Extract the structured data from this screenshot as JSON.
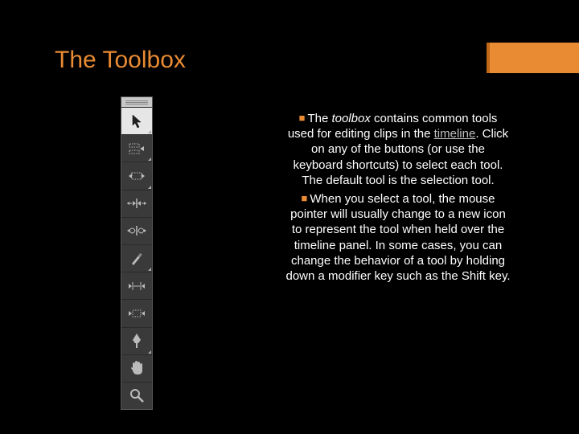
{
  "title": "The Toolbox",
  "tools": [
    "selection-tool",
    "track-select-tool",
    "ripple-edit-tool",
    "rolling-edit-tool",
    "rate-stretch-tool",
    "razor-tool",
    "slip-tool",
    "slide-tool",
    "pen-tool",
    "hand-tool",
    "zoom-tool"
  ],
  "selected_tool_index": 0,
  "paragraphs": {
    "p1_pre": "The ",
    "p1_italic": "toolbox",
    "p1_mid": " contains common tools used for editing clips in the ",
    "p1_link": "timeline",
    "p1_post": ". Click on any of the buttons (or use the keyboard shortcuts) to select each tool. The default tool is the selection tool.",
    "p2": "When you select a tool, the mouse pointer will usually change to a new icon to represent the tool when held over the timeline panel. In some cases, you can change the behavior of a tool by holding down a modifier key such as the Shift key."
  },
  "colors": {
    "accent": "#e98b33"
  }
}
